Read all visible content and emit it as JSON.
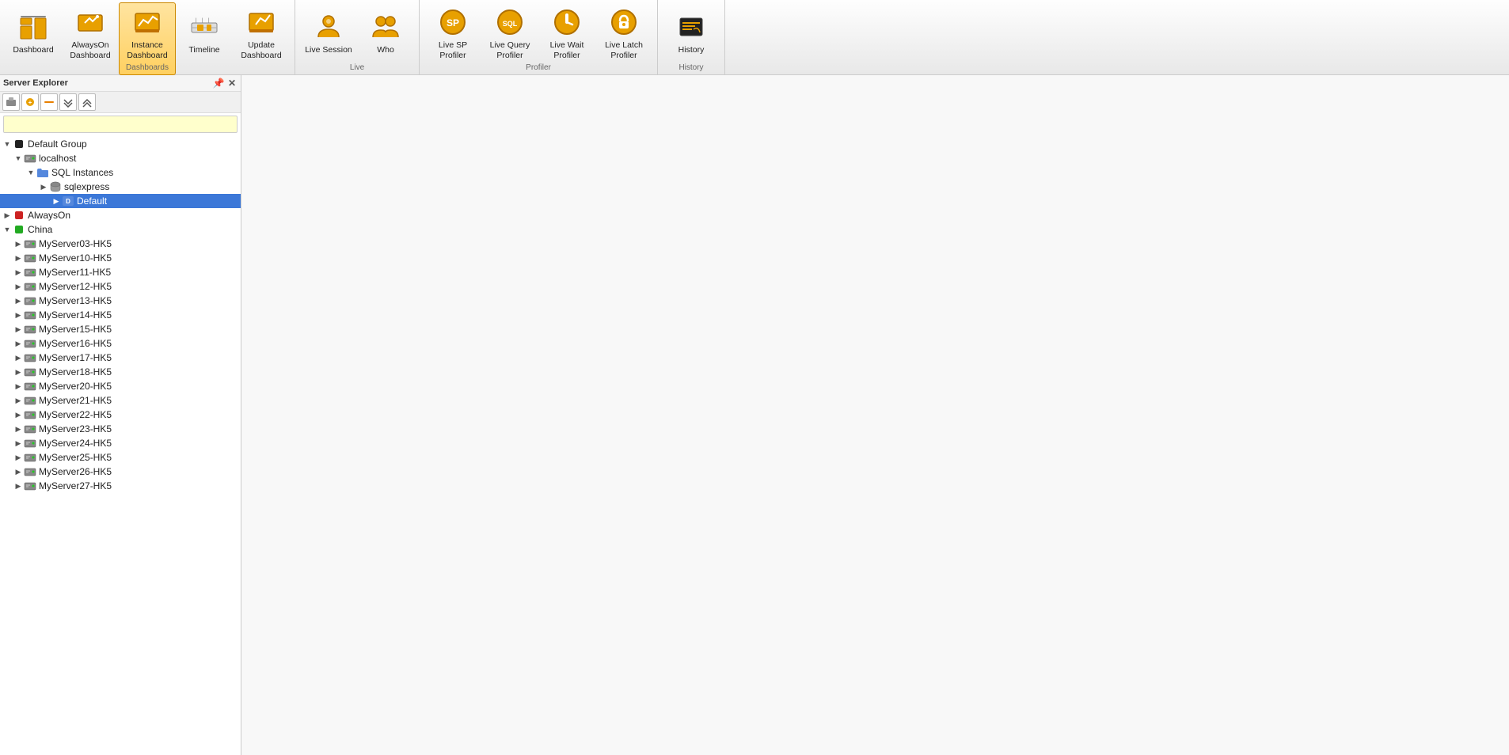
{
  "toolbar": {
    "groups": [
      {
        "label": "Dashboards",
        "buttons": [
          {
            "id": "dashboard",
            "label": "Dashboard",
            "active": false
          },
          {
            "id": "alwayson-dashboard",
            "label": "AlwaysOn Dashboard",
            "active": false
          },
          {
            "id": "instance-dashboard",
            "label": "Instance Dashboard",
            "active": true
          },
          {
            "id": "timeline",
            "label": "Timeline",
            "active": false
          },
          {
            "id": "update-dashboard",
            "label": "Update Dashboard",
            "active": false
          }
        ]
      },
      {
        "label": "Live",
        "buttons": [
          {
            "id": "live-session",
            "label": "Live Session",
            "active": false
          },
          {
            "id": "who",
            "label": "Who",
            "active": false
          }
        ]
      },
      {
        "label": "Profiler",
        "buttons": [
          {
            "id": "live-sp-profiler",
            "label": "Live SP Profiler",
            "active": false
          },
          {
            "id": "live-query-profiler",
            "label": "Live Query Profiler",
            "active": false
          },
          {
            "id": "live-wait-profiler",
            "label": "Live Wait Profiler",
            "active": false
          },
          {
            "id": "live-latch-profiler",
            "label": "Live Latch Profiler",
            "active": false
          }
        ]
      },
      {
        "label": "History",
        "buttons": [
          {
            "id": "history",
            "label": "History",
            "active": false
          }
        ]
      }
    ]
  },
  "server_explorer": {
    "title": "Server Explorer",
    "search_placeholder": "",
    "tree": [
      {
        "id": "default-group",
        "label": "Default Group",
        "level": 0,
        "type": "group-black",
        "expanded": true,
        "children": [
          {
            "id": "localhost",
            "label": "localhost",
            "level": 1,
            "type": "server",
            "expanded": true,
            "children": [
              {
                "id": "sql-instances",
                "label": "SQL Instances",
                "level": 2,
                "type": "folder-blue",
                "expanded": true,
                "children": [
                  {
                    "id": "sqlexpress",
                    "label": "sqlexpress",
                    "level": 3,
                    "type": "db-gray",
                    "expanded": false,
                    "children": [
                      {
                        "id": "default",
                        "label": "Default",
                        "level": 4,
                        "type": "db-blue",
                        "expanded": false,
                        "selected": true,
                        "children": []
                      }
                    ]
                  }
                ]
              }
            ]
          }
        ]
      },
      {
        "id": "alwayson",
        "label": "AlwaysOn",
        "level": 0,
        "type": "group-red",
        "expanded": false,
        "children": []
      },
      {
        "id": "china",
        "label": "China",
        "level": 0,
        "type": "group-green",
        "expanded": true,
        "children": [
          {
            "id": "myserver03",
            "label": "MyServer03-HK5",
            "level": 1,
            "type": "server-gray",
            "expanded": false
          },
          {
            "id": "myserver10",
            "label": "MyServer10-HK5",
            "level": 1,
            "type": "server-gray",
            "expanded": false
          },
          {
            "id": "myserver11",
            "label": "MyServer11-HK5",
            "level": 1,
            "type": "server-gray",
            "expanded": false
          },
          {
            "id": "myserver12",
            "label": "MyServer12-HK5",
            "level": 1,
            "type": "server-gray",
            "expanded": false
          },
          {
            "id": "myserver13",
            "label": "MyServer13-HK5",
            "level": 1,
            "type": "server-gray",
            "expanded": false
          },
          {
            "id": "myserver14",
            "label": "MyServer14-HK5",
            "level": 1,
            "type": "server-gray",
            "expanded": false
          },
          {
            "id": "myserver15",
            "label": "MyServer15-HK5",
            "level": 1,
            "type": "server-gray",
            "expanded": false
          },
          {
            "id": "myserver16",
            "label": "MyServer16-HK5",
            "level": 1,
            "type": "server-gray",
            "expanded": false
          },
          {
            "id": "myserver17",
            "label": "MyServer17-HK5",
            "level": 1,
            "type": "server-gray",
            "expanded": false
          },
          {
            "id": "myserver18",
            "label": "MyServer18-HK5",
            "level": 1,
            "type": "server-gray",
            "expanded": false
          },
          {
            "id": "myserver20",
            "label": "MyServer20-HK5",
            "level": 1,
            "type": "server-gray",
            "expanded": false
          },
          {
            "id": "myserver21",
            "label": "MyServer21-HK5",
            "level": 1,
            "type": "server-gray",
            "expanded": false
          },
          {
            "id": "myserver22",
            "label": "MyServer22-HK5",
            "level": 1,
            "type": "server-gray",
            "expanded": false
          },
          {
            "id": "myserver23",
            "label": "MyServer23-HK5",
            "level": 1,
            "type": "server-gray",
            "expanded": false
          },
          {
            "id": "myserver24",
            "label": "MyServer24-HK5",
            "level": 1,
            "type": "server-gray",
            "expanded": false
          },
          {
            "id": "myserver25",
            "label": "MyServer25-HK5",
            "level": 1,
            "type": "server-gray",
            "expanded": false
          },
          {
            "id": "myserver26",
            "label": "MyServer26-HK5",
            "level": 1,
            "type": "server-gray",
            "expanded": false
          },
          {
            "id": "myserver27",
            "label": "MyServer27-HK5",
            "level": 1,
            "type": "server-gray",
            "expanded": false
          }
        ]
      }
    ]
  }
}
